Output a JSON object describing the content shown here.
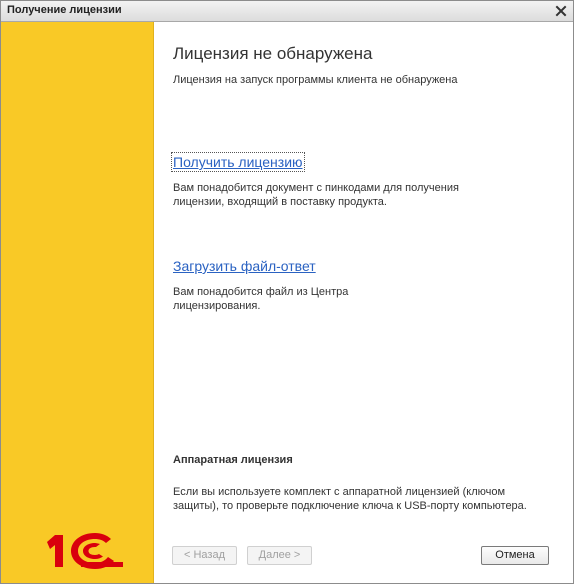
{
  "window": {
    "title": "Получение лицензии"
  },
  "content": {
    "heading": "Лицензия не обнаружена",
    "subtitle": "Лицензия на запуск программы клиента не обнаружена",
    "get_license": {
      "link": "Получить лицензию",
      "description": "Вам понадобится документ с пинкодами для получения лицензии, входящий в поставку продукта."
    },
    "load_response": {
      "link": "Загрузить файл-ответ",
      "description": "Вам понадобится файл из Центра лицензирования."
    },
    "hardware": {
      "title": "Аппаратная лицензия",
      "description": "Если вы используете комплект с аппаратной лицензией (ключом защиты), то проверьте подключение ключа к USB-порту компьютера."
    }
  },
  "buttons": {
    "back": "< Назад",
    "next": "Далее >",
    "cancel": "Отмена"
  },
  "logo": {
    "text": "1С"
  },
  "colors": {
    "sidebar": "#f9c926",
    "logo": "#d9000d",
    "link": "#2a62c2"
  }
}
